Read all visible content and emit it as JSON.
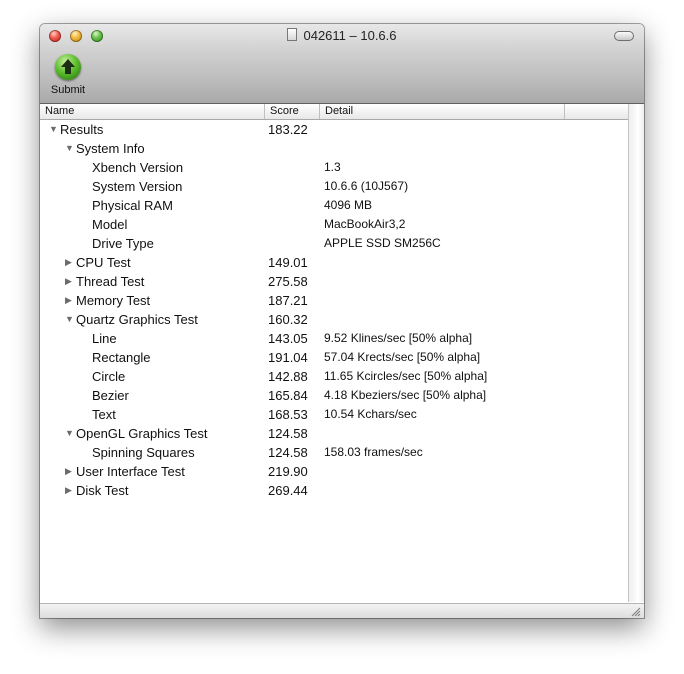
{
  "window": {
    "title": "042611 – 10.6.6"
  },
  "toolbar": {
    "submit_label": "Submit"
  },
  "columns": {
    "name": "Name",
    "score": "Score",
    "detail": "Detail"
  },
  "rows": [
    {
      "name": "Results",
      "score": "183.22",
      "detail": "",
      "level": 0,
      "expander": "open"
    },
    {
      "name": "System Info",
      "score": "",
      "detail": "",
      "level": 1,
      "expander": "open"
    },
    {
      "name": "Xbench Version",
      "score": "",
      "detail": "1.3",
      "level": 2,
      "expander": "none"
    },
    {
      "name": "System Version",
      "score": "",
      "detail": "10.6.6 (10J567)",
      "level": 2,
      "expander": "none"
    },
    {
      "name": "Physical RAM",
      "score": "",
      "detail": "4096 MB",
      "level": 2,
      "expander": "none"
    },
    {
      "name": "Model",
      "score": "",
      "detail": "MacBookAir3,2",
      "level": 2,
      "expander": "none"
    },
    {
      "name": "Drive Type",
      "score": "",
      "detail": "APPLE SSD SM256C",
      "level": 2,
      "expander": "none"
    },
    {
      "name": "CPU Test",
      "score": "149.01",
      "detail": "",
      "level": 1,
      "expander": "closed"
    },
    {
      "name": "Thread Test",
      "score": "275.58",
      "detail": "",
      "level": 1,
      "expander": "closed"
    },
    {
      "name": "Memory Test",
      "score": "187.21",
      "detail": "",
      "level": 1,
      "expander": "closed"
    },
    {
      "name": "Quartz Graphics Test",
      "score": "160.32",
      "detail": "",
      "level": 1,
      "expander": "open"
    },
    {
      "name": "Line",
      "score": "143.05",
      "detail": "9.52 Klines/sec [50% alpha]",
      "level": 2,
      "expander": "none"
    },
    {
      "name": "Rectangle",
      "score": "191.04",
      "detail": "57.04 Krects/sec [50% alpha]",
      "level": 2,
      "expander": "none"
    },
    {
      "name": "Circle",
      "score": "142.88",
      "detail": "11.65 Kcircles/sec [50% alpha]",
      "level": 2,
      "expander": "none"
    },
    {
      "name": "Bezier",
      "score": "165.84",
      "detail": "4.18 Kbeziers/sec [50% alpha]",
      "level": 2,
      "expander": "none"
    },
    {
      "name": "Text",
      "score": "168.53",
      "detail": "10.54 Kchars/sec",
      "level": 2,
      "expander": "none"
    },
    {
      "name": "OpenGL Graphics Test",
      "score": "124.58",
      "detail": "",
      "level": 1,
      "expander": "open"
    },
    {
      "name": "Spinning Squares",
      "score": "124.58",
      "detail": "158.03 frames/sec",
      "level": 2,
      "expander": "none"
    },
    {
      "name": "User Interface Test",
      "score": "219.90",
      "detail": "",
      "level": 1,
      "expander": "closed"
    },
    {
      "name": "Disk Test",
      "score": "269.44",
      "detail": "",
      "level": 1,
      "expander": "closed"
    }
  ],
  "icons": {
    "doc": "document-icon",
    "submit": "up-arrow-icon",
    "resize": "resize-grip-icon"
  },
  "colors": {
    "close": "#f25a4f",
    "minimize": "#f4b940",
    "zoom": "#69c24a",
    "submit_green": "#5ebf2d"
  }
}
